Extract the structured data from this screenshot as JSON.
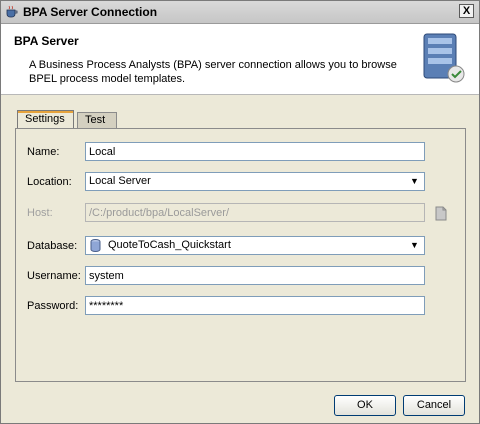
{
  "window": {
    "title": "BPA Server Connection",
    "close_label": "X"
  },
  "header": {
    "title": "BPA Server",
    "description": "A Business Process Analysts (BPA) server connection allows you to browse BPEL process model templates."
  },
  "tabs": [
    {
      "label": "Settings",
      "active": true
    },
    {
      "label": "Test",
      "active": false
    }
  ],
  "form": {
    "name": {
      "label": "Name:",
      "value": "Local"
    },
    "location": {
      "label": "Location:",
      "value": "Local Server"
    },
    "host": {
      "label": "Host:",
      "value": "/C:/product/bpa/LocalServer/"
    },
    "database": {
      "label": "Database:",
      "value": "QuoteToCash_Quickstart"
    },
    "username": {
      "label": "Username:",
      "value": "system"
    },
    "password": {
      "label": "Password:",
      "value": "********"
    }
  },
  "buttons": {
    "ok": "OK",
    "cancel": "Cancel"
  }
}
